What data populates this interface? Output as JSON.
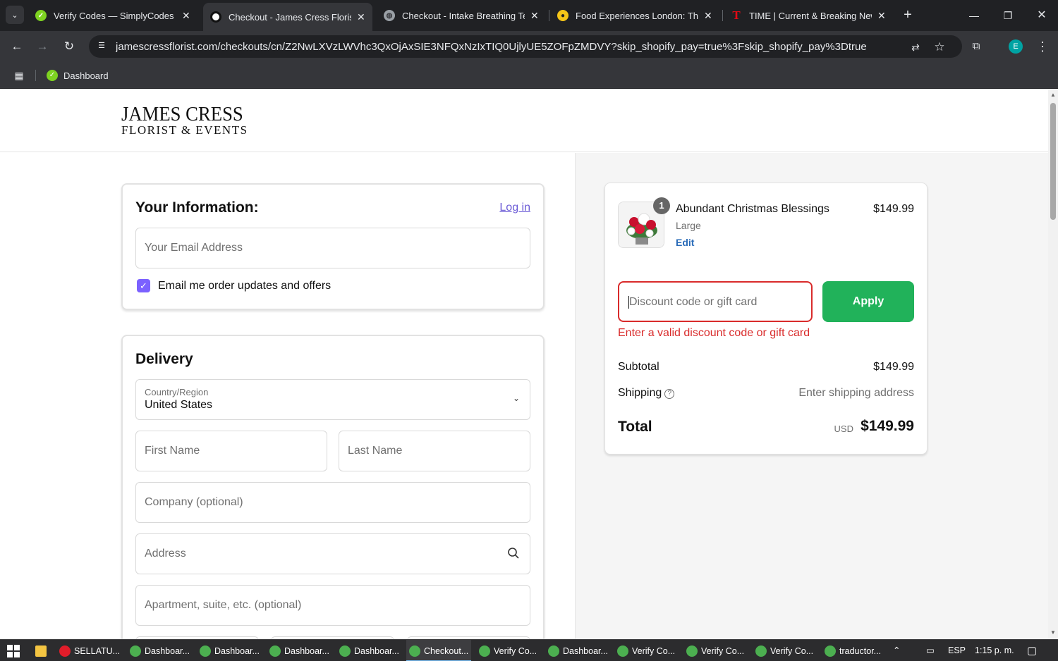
{
  "browser": {
    "tabs": [
      {
        "label": "Verify Codes — SimplyCodes",
        "icon": "simplycodes-icon",
        "icon_color": "#7ed321",
        "active": false
      },
      {
        "label": "Checkout - James Cress Florist",
        "icon": "jamescress-icon",
        "icon_color": "#111111",
        "active": true
      },
      {
        "label": "Checkout - Intake Breathing Te",
        "icon": "globe-icon",
        "icon_color": "#9aa0a6",
        "active": false
      },
      {
        "label": "Food Experiences London: The",
        "icon": "food-icon",
        "icon_color": "#f5c518",
        "active": false
      },
      {
        "label": "TIME | Current & Breaking New",
        "icon": "time-icon",
        "icon_color": "#e50914",
        "active": false
      }
    ],
    "url": "jamescressflorist.com/checkouts/cn/Z2NwLXVzLWVhc3QxOjAxSIE3NFQxNzIxTIQ0UjlyUE5ZOFpZMDVY?skip_shopify_pay=true%3Fskip_shopify_pay%3Dtrue",
    "profile_initial": "E",
    "bookmark": "Dashboard"
  },
  "header": {
    "logo_line1": "JAMES CRESS",
    "logo_line2": "FLORIST & EVENTS"
  },
  "information": {
    "title": "Your Information:",
    "login_link": "Log in",
    "email_placeholder": "Your Email Address",
    "marketing_checkbox_label": "Email me order updates and offers",
    "marketing_checked": true
  },
  "delivery": {
    "title": "Delivery",
    "country_label": "Country/Region",
    "country_value": "United States",
    "first_name_placeholder": "First Name",
    "last_name_placeholder": "Last Name",
    "company_placeholder": "Company (optional)",
    "address_placeholder": "Address",
    "apartment_placeholder": "Apartment, suite, etc. (optional)"
  },
  "order": {
    "quantity": "1",
    "product_name": "Abundant Christmas Blessings",
    "product_price": "$149.99",
    "variant": "Large",
    "edit_label": "Edit",
    "discount_placeholder": "Discount code or gift card",
    "apply_label": "Apply",
    "discount_error": "Enter a valid discount code or gift card",
    "subtotal_label": "Subtotal",
    "subtotal_value": "$149.99",
    "shipping_label": "Shipping",
    "shipping_value": "Enter shipping address",
    "total_label": "Total",
    "total_currency": "USD",
    "total_value": "$149.99"
  },
  "taskbar": {
    "apps": [
      {
        "label": "SELLATU...",
        "icon_color": "#e11d2a",
        "active": false
      },
      {
        "label": "Dashboar...",
        "icon_color": "#4caf50",
        "active": false
      },
      {
        "label": "Dashboar...",
        "icon_color": "#4caf50",
        "active": false
      },
      {
        "label": "Dashboar...",
        "icon_color": "#4caf50",
        "active": false
      },
      {
        "label": "Dashboar...",
        "icon_color": "#4caf50",
        "active": false
      },
      {
        "label": "Checkout...",
        "icon_color": "#4caf50",
        "active": true
      },
      {
        "label": "Verify Co...",
        "icon_color": "#4caf50",
        "active": false
      },
      {
        "label": "Dashboar...",
        "icon_color": "#4caf50",
        "active": false
      },
      {
        "label": "Verify Co...",
        "icon_color": "#4caf50",
        "active": false
      },
      {
        "label": "Verify Co...",
        "icon_color": "#4caf50",
        "active": false
      },
      {
        "label": "Verify Co...",
        "icon_color": "#4caf50",
        "active": false
      },
      {
        "label": "traductor...",
        "icon_color": "#4caf50",
        "active": false
      }
    ],
    "language": "ESP",
    "time": "1:15 p. m."
  },
  "colors": {
    "accent_purple": "#7b61ff",
    "apply_green": "#21b25a",
    "error_red": "#d92b2b",
    "edit_blue": "#2a6bb8"
  }
}
